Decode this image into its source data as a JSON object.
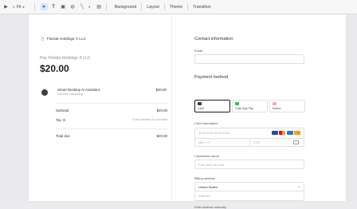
{
  "toolbar": {
    "fit_label": "Fit",
    "menus": [
      "Background",
      "Layout",
      "Theme",
      "Transition"
    ],
    "icons": [
      "play-icon",
      "pointer-icon",
      "text-icon",
      "image-icon",
      "shapes-icon",
      "line-icon",
      "chart-icon"
    ]
  },
  "checkout": {
    "merchant": "Florida Holdings X LLC",
    "pay_label": "Pay Florida Holdings X LLC",
    "amount": "$20.00",
    "item": {
      "name": "Smart Desktop AI Assistant",
      "desc": "One-time onboarding",
      "price": "$20.00"
    },
    "subtotal_label": "Subtotal",
    "subtotal_value": "$20.00",
    "tax_label": "Tax",
    "tax_hint": "Enter address to calculate",
    "total_label": "Total due",
    "total_value": "$20.00"
  },
  "form": {
    "contact_title": "Contact information",
    "email_label": "Email",
    "email_placeholder": "",
    "payment_title": "Payment method",
    "methods": [
      {
        "label": "Card",
        "color": "#3b3b3f"
      },
      {
        "label": "Cash App Pay",
        "color": "#22c55e"
      },
      {
        "label": "Klarna",
        "color": "#f4a6c0"
      }
    ],
    "card_info_label": "Card information",
    "card_number_placeholder": "1234 1234 1234 1234",
    "card_exp_placeholder": "MM / YY",
    "card_cvc_placeholder": "CVC",
    "brand_colors": [
      "#1a4fa0",
      "#eb001b",
      "#2e77bb",
      "#f79e1b"
    ],
    "cardholder_label": "Cardholder name",
    "cardholder_placeholder": "Full name on card",
    "billing_label": "Billing address",
    "country": "United States",
    "address_placeholder": "Address",
    "manual_link": "Enter address manually"
  }
}
